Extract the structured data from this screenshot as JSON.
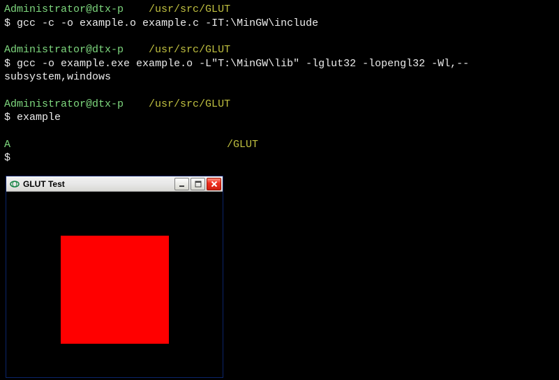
{
  "terminal": {
    "blocks": [
      {
        "user_host": "Administrator@dtx-p",
        "path": "/usr/src/GLUT",
        "command": "gcc -c -o example.o example.c -IT:\\MinGW\\include"
      },
      {
        "user_host": "Administrator@dtx-p",
        "path": "/usr/src/GLUT",
        "command": "gcc -o example.exe example.o -L\"T:\\MinGW\\lib\" -lglut32 -lopengl32 -Wl,--subsystem,windows"
      },
      {
        "user_host": "Administrator@dtx-p",
        "path": "/usr/src/GLUT",
        "command": "example"
      },
      {
        "user_host": "A",
        "path": "/GLUT",
        "command": ""
      }
    ],
    "prompt_symbol": "$"
  },
  "glut_window": {
    "title": "GLUT Test",
    "colors": {
      "background": "#000000",
      "square": "#ff0000"
    }
  }
}
